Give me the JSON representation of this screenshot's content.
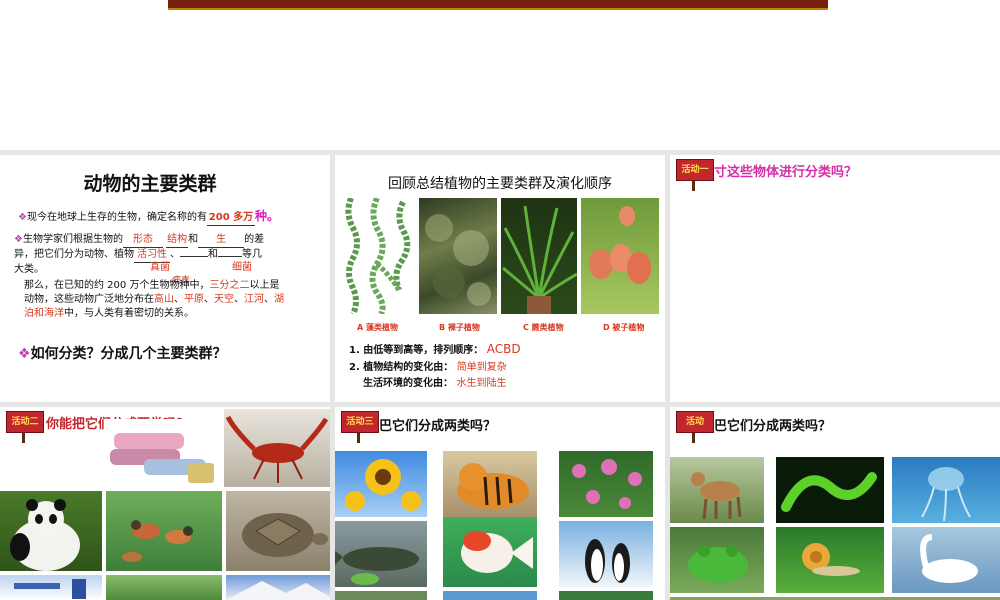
{
  "slide1": {
    "title": "动物的主要类群",
    "line1_prefix": "现今在地球上生存的生物，确定名称的有",
    "line1_value": "200 多万",
    "line1_unit": "种。",
    "line2_prefix": "生物学家们根据生物的",
    "blank_xingtai": "形态",
    "blank_jiegou": "结构",
    "word_he1": "和",
    "blank_sheng": "生",
    "line2_suffix": "的差",
    "line3_prefix": "异，把它们分为动物、植物",
    "blank_huoxi": "活习性",
    "word_dun": "、",
    "word_he2": "和",
    "line3_suffix": "等几",
    "line4": "大类。",
    "blank_zhenjun": "真菌",
    "blank_xijun": "细菌",
    "blank_bingdu": "病毒",
    "para_a": "那么，在已知的约 200 万个生物物种中，",
    "para_b": "三分之二",
    "para_c": "以上是",
    "para_d": "动物，这些动物广泛地分布在",
    "place1": "高山",
    "place2": "平原",
    "place3": "天空",
    "place4": "江河",
    "place5": "湖",
    "para_e": "泊和海洋",
    "para_f": "中，与人类有着密切的关系。",
    "sep": "、",
    "question": "如何分类？分成几个主要类群？"
  },
  "slide2": {
    "title": "回顾总结植物的主要类群及演化顺序",
    "labels": [
      "A 藻类植物",
      "B 裸子植物",
      "C 蕨类植物",
      "D 被子植物"
    ],
    "q1_label": "1. 由低等到高等，排列顺序：",
    "q1_answer": "ACBD",
    "q2_label": "2. 植物结构的变化由：",
    "q2_answer": "简单到复杂",
    "q3_label": "生活环境的变化由：",
    "q3_answer": "水生到陆生"
  },
  "slide3": {
    "badge": "活动一",
    "question": "寸这些物体进行分类吗？"
  },
  "slide4": {
    "badge": "活动二",
    "question": "你能把它们分成两类吗？"
  },
  "slide5": {
    "badge": "活动三",
    "question": "巴它们分成两类吗？"
  },
  "slide6": {
    "badge": "活动",
    "question": "巴它们分成两类吗？"
  },
  "colors": {
    "accent_red": "#d9381e",
    "accent_magenta": "#e11bc8",
    "badge_red": "#c2272d",
    "badge_text": "#ffe04a"
  }
}
